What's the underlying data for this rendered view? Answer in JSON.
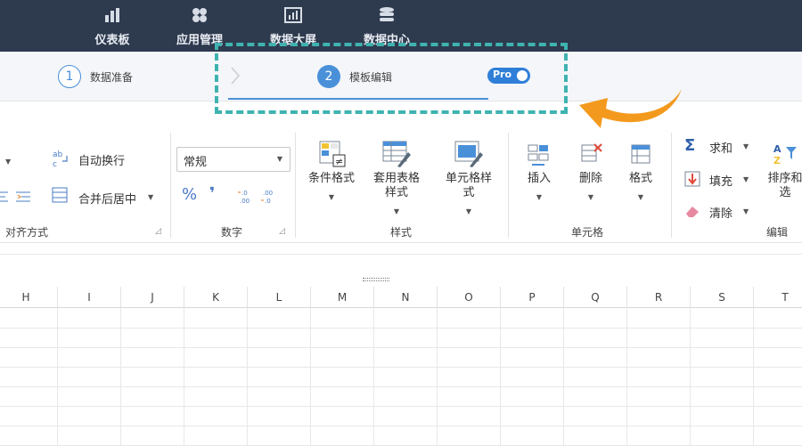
{
  "nav": {
    "items": [
      {
        "label": "仪表板",
        "icon": "bar-chart-icon"
      },
      {
        "label": "应用管理",
        "icon": "apps-icon"
      },
      {
        "label": "数据大屏",
        "icon": "screen-chart-icon"
      },
      {
        "label": "数据中心",
        "icon": "database-icon"
      }
    ]
  },
  "steps": [
    {
      "num": "1",
      "label": "数据准备"
    },
    {
      "num": "2",
      "label": "模板编辑"
    }
  ],
  "pro_toggle": {
    "label": "Pro",
    "on": true
  },
  "ribbon": {
    "align": {
      "wrap_text": "自动换行",
      "merge_center": "合并后居中",
      "title": "对齐方式"
    },
    "number": {
      "format_value": "常规",
      "percent": "%",
      "comma": "❜",
      "title": "数字"
    },
    "style": {
      "conditional_format": "条件格式",
      "table_style_1": "套用表格",
      "table_style_2": "样式",
      "cell_style_1": "单元格样",
      "cell_style_2": "式",
      "title": "样式"
    },
    "cells": {
      "insert": "插入",
      "delete": "删除",
      "format": "格式",
      "title": "单元格"
    },
    "edit": {
      "sum": "求和",
      "fill": "填充",
      "clear": "清除",
      "sort_1": "排序和",
      "sort_2": "选",
      "title": "编辑"
    }
  },
  "grid": {
    "columns": [
      "H",
      "I",
      "J",
      "K",
      "L",
      "M",
      "N",
      "O",
      "P",
      "Q",
      "R",
      "S",
      "T"
    ]
  },
  "colors": {
    "nav_bg": "#2e3a4e",
    "accent": "#4a90d9",
    "highlight": "#3fb3b0",
    "arrow": "#f39a1e"
  }
}
